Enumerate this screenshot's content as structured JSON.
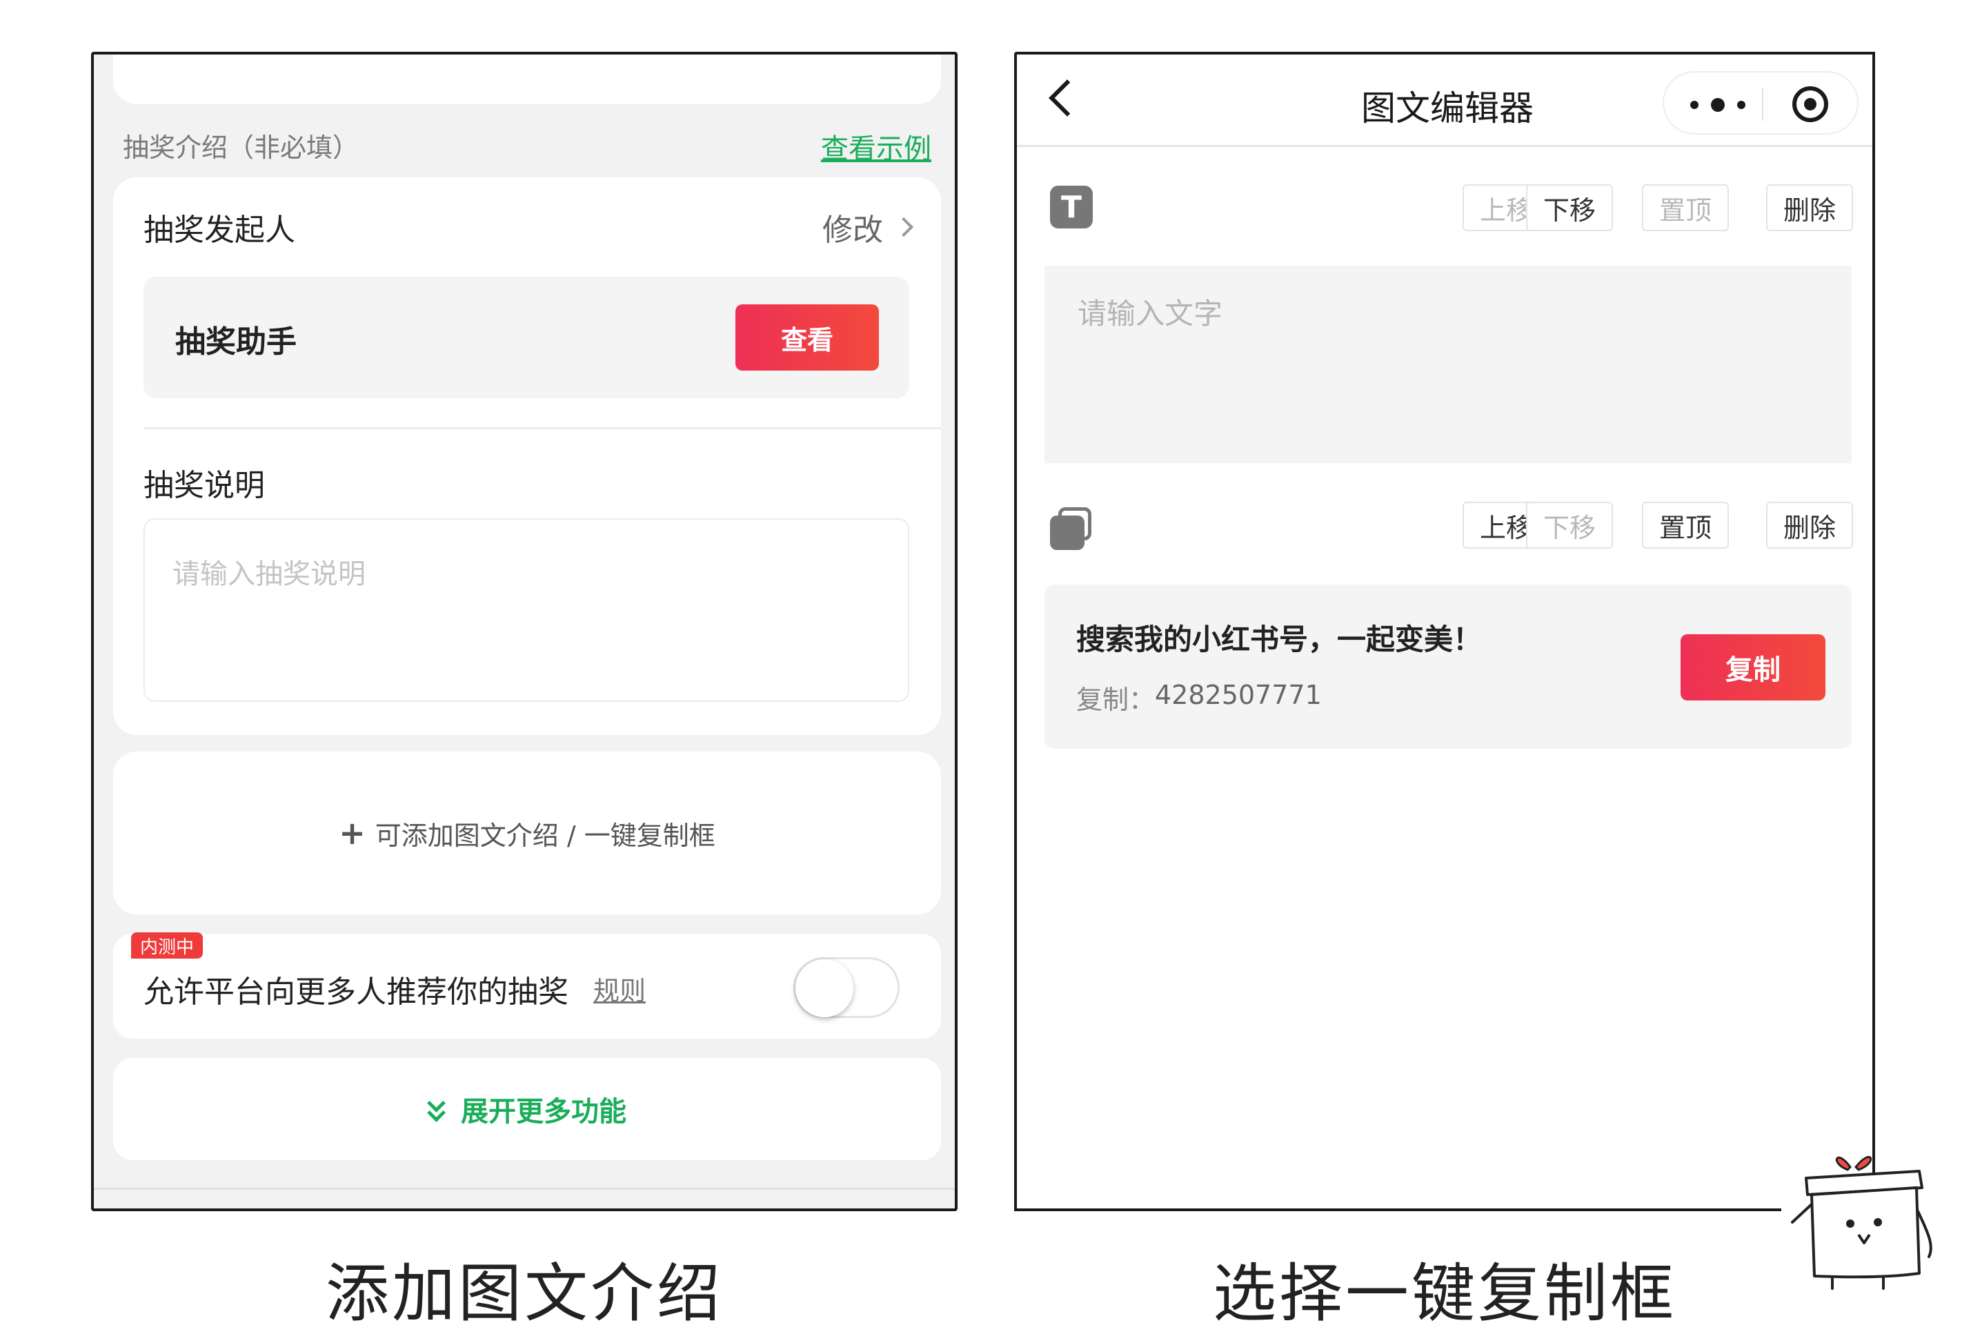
{
  "left": {
    "intro_label": "抽奖介绍（非必填）",
    "view_example": "查看示例",
    "sponsor": {
      "title": "抽奖发起人",
      "modify": "修改",
      "name": "抽奖助手",
      "view_button": "查看"
    },
    "description": {
      "title": "抽奖说明",
      "placeholder": "请输入抽奖说明"
    },
    "add_block": "可添加图文介绍 / 一键复制框",
    "recommend": {
      "badge": "内测中",
      "text": "允许平台向更多人推荐你的抽奖",
      "rules": "规则",
      "toggle_on": false
    },
    "expand": "展开更多功能",
    "caption": "添加图文介绍"
  },
  "right": {
    "nav_title": "图文编辑器",
    "text_block": {
      "icon_letter": "T",
      "up": "上移",
      "down": "下移",
      "top": "置顶",
      "delete": "删除",
      "placeholder": "请输入文字"
    },
    "copy_block": {
      "up": "上移",
      "down": "下移",
      "top": "置顶",
      "delete": "删除",
      "title": "搜索我的小红书号，一起变美！",
      "label": "复制：",
      "value": "4282507771",
      "button": "复制"
    },
    "caption": "选择一键复制框"
  },
  "colors": {
    "accent_red": "#ee3056",
    "accent_green": "#1aad5a"
  }
}
